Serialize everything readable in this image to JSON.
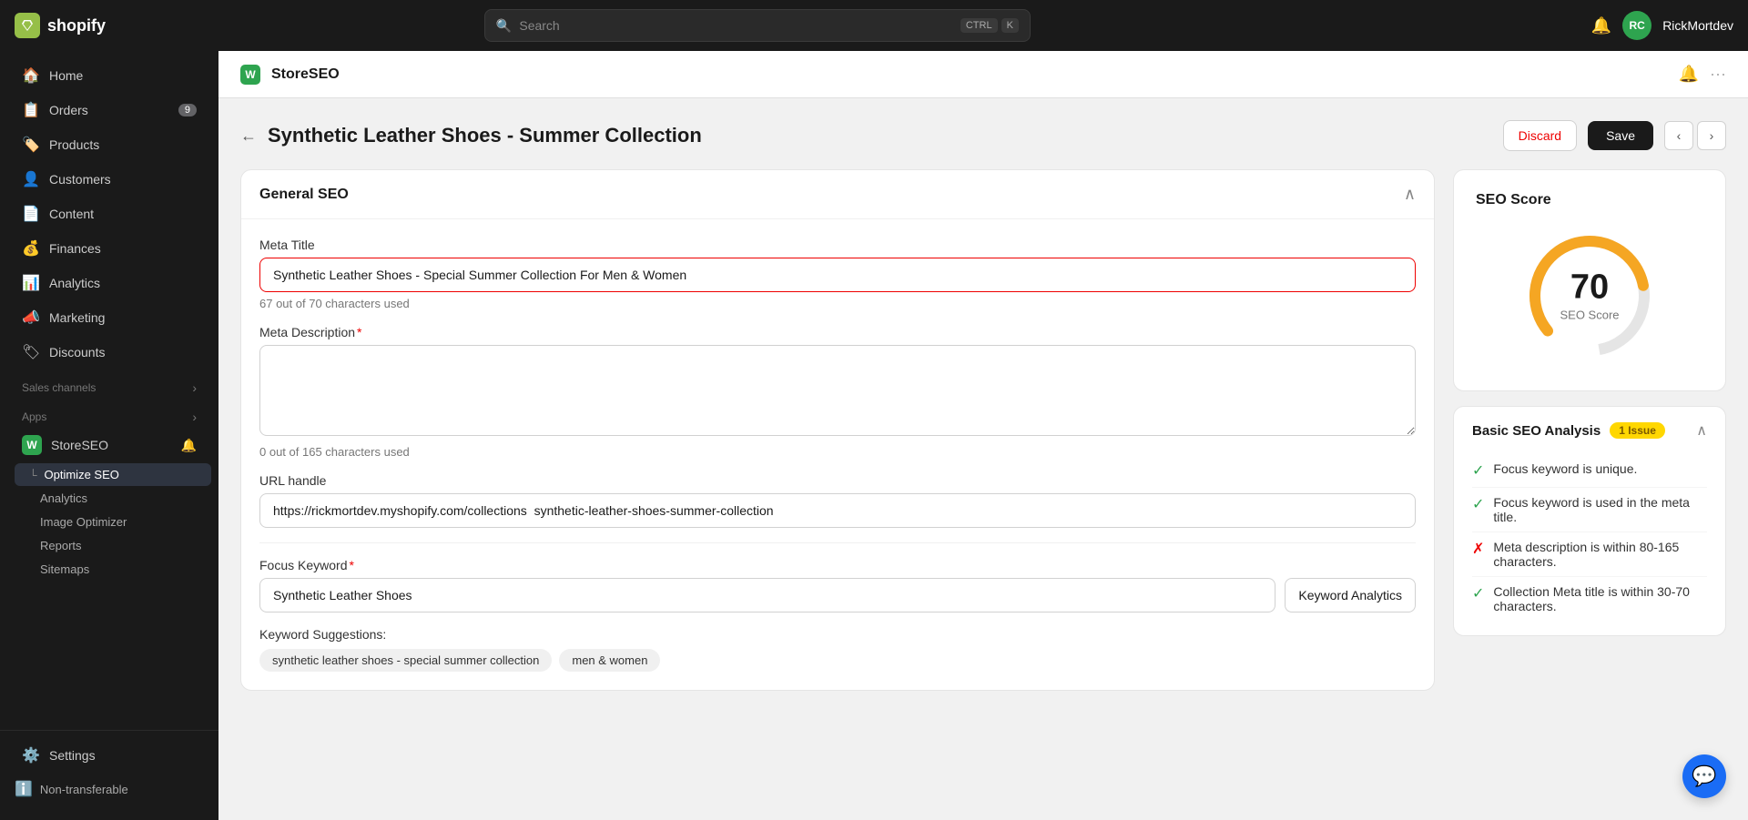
{
  "topbar": {
    "logo_text": "shopify",
    "search_placeholder": "Search",
    "search_key1": "CTRL",
    "search_key2": "K",
    "username": "RickMortdev"
  },
  "sidebar": {
    "items": [
      {
        "id": "home",
        "label": "Home",
        "icon": "🏠",
        "badge": null
      },
      {
        "id": "orders",
        "label": "Orders",
        "icon": "📋",
        "badge": "9"
      },
      {
        "id": "products",
        "label": "Products",
        "icon": "🏷️",
        "badge": null
      },
      {
        "id": "customers",
        "label": "Customers",
        "icon": "👤",
        "badge": null
      },
      {
        "id": "content",
        "label": "Content",
        "icon": "📄",
        "badge": null
      },
      {
        "id": "finances",
        "label": "Finances",
        "icon": "💰",
        "badge": null
      },
      {
        "id": "analytics",
        "label": "Analytics",
        "icon": "📊",
        "badge": null
      },
      {
        "id": "marketing",
        "label": "Marketing",
        "icon": "📣",
        "badge": null
      },
      {
        "id": "discounts",
        "label": "Discounts",
        "icon": "🏷",
        "badge": null
      }
    ],
    "sections": {
      "sales_channels": "Sales channels",
      "apps": "Apps"
    },
    "app_item": {
      "label": "StoreSEO",
      "icon": "W"
    },
    "sub_items": [
      {
        "id": "optimize-seo",
        "label": "Optimize SEO",
        "active": true
      },
      {
        "id": "analytics",
        "label": "Analytics",
        "active": false
      },
      {
        "id": "image-optimizer",
        "label": "Image Optimizer",
        "active": false
      },
      {
        "id": "reports",
        "label": "Reports",
        "active": false
      },
      {
        "id": "sitemaps",
        "label": "Sitemaps",
        "active": false
      }
    ],
    "settings": "Settings",
    "non_transferable": "Non-transferable"
  },
  "app_header": {
    "logo": "W",
    "title": "StoreSEO"
  },
  "page": {
    "title": "Synthetic Leather Shoes - Summer Collection",
    "discard_label": "Discard",
    "save_label": "Save"
  },
  "general_seo": {
    "section_title": "General SEO",
    "meta_title_label": "Meta Title",
    "meta_title_value": "Synthetic Leather Shoes - Special Summer Collection For Men & Women",
    "meta_title_highlight": "Synthetic Leather Shoes",
    "meta_title_chars": "67 out of 70 characters used",
    "meta_desc_label": "Meta Description",
    "meta_desc_required": true,
    "meta_desc_value": "",
    "meta_desc_chars": "0 out of 165 characters used",
    "url_handle_label": "URL handle",
    "url_handle_value": "https://rickmortdev.myshopify.com/collections  synthetic-leather-shoes-summer-collection",
    "focus_keyword_label": "Focus Keyword",
    "focus_keyword_required": true,
    "focus_keyword_value": "Synthetic Leather Shoes",
    "keyword_analytics_btn": "Keyword Analytics",
    "keyword_suggestions_label": "Keyword Suggestions:",
    "keyword_tags": [
      "synthetic leather shoes - special summer collection",
      "men & women"
    ]
  },
  "seo_score": {
    "title": "SEO Score",
    "score": "70",
    "label": "SEO Score",
    "gauge_value": 70
  },
  "basic_seo": {
    "title": "Basic SEO Analysis",
    "issue_badge": "1 Issue",
    "items": [
      {
        "status": "ok",
        "text": "Focus keyword is unique."
      },
      {
        "status": "ok",
        "text": "Focus keyword is used in the meta title."
      },
      {
        "status": "fail",
        "text": "Meta description is within 80-165 characters."
      },
      {
        "status": "ok",
        "text": "Collection Meta title is within 30-70 characters."
      }
    ]
  },
  "chat": {
    "icon": "💬"
  }
}
